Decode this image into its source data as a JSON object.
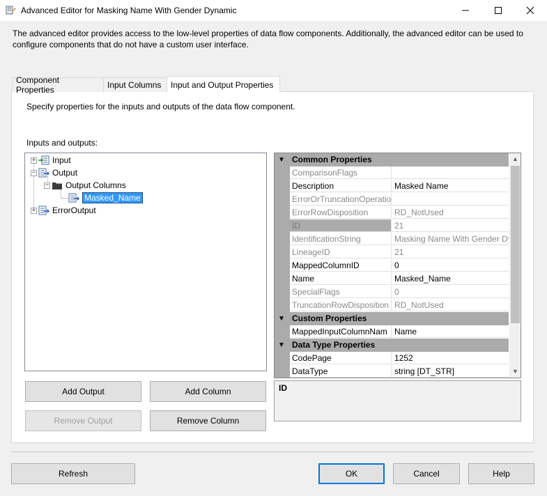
{
  "window": {
    "title": "Advanced Editor for Masking Name With Gender Dynamic"
  },
  "description": "The advanced editor provides access to the low-level properties of data flow components. Additionally, the advanced editor can be used to configure components that do not have a custom user interface.",
  "tabs": [
    {
      "label": "Component Properties",
      "active": false
    },
    {
      "label": "Input Columns",
      "active": false
    },
    {
      "label": "Input and Output Properties",
      "active": true
    }
  ],
  "panel": {
    "description": "Specify properties for the inputs and outputs of the data flow component.",
    "io_label": "Inputs and outputs:"
  },
  "tree": {
    "input": "Input",
    "output": "Output",
    "output_columns": "Output Columns",
    "masked_name": "Masked_Name",
    "error_output": "ErrorOutput"
  },
  "buttons": {
    "add_output": "Add Output",
    "add_column": "Add Column",
    "remove_output": "Remove Output",
    "remove_column": "Remove Column",
    "refresh": "Refresh",
    "ok": "OK",
    "cancel": "Cancel",
    "help": "Help"
  },
  "properties": {
    "common_header": "Common Properties",
    "custom_header": "Custom Properties",
    "datatype_header": "Data Type Properties",
    "rows": [
      {
        "name": "ComparisonFlags",
        "value": ""
      },
      {
        "name": "Description",
        "value": "Masked Name"
      },
      {
        "name": "ErrorOrTruncationOperatio",
        "value": ""
      },
      {
        "name": "ErrorRowDisposition",
        "value": "RD_NotUsed"
      },
      {
        "name": "ID",
        "value": "21"
      },
      {
        "name": "IdentificationString",
        "value": "Masking Name With Gender Dy"
      },
      {
        "name": "LineageID",
        "value": "21"
      },
      {
        "name": "MappedColumnID",
        "value": "0"
      },
      {
        "name": "Name",
        "value": "Masked_Name"
      },
      {
        "name": "SpecialFlags",
        "value": "0"
      },
      {
        "name": "TruncationRowDisposition",
        "value": "RD_NotUsed"
      }
    ],
    "custom_rows": [
      {
        "name": "MappedInputColumnNam",
        "value": "Name"
      }
    ],
    "datatype_rows": [
      {
        "name": "CodePage",
        "value": "1252"
      },
      {
        "name": "DataType",
        "value": "string [DT_STR]"
      }
    ],
    "selected_description_title": "ID"
  }
}
